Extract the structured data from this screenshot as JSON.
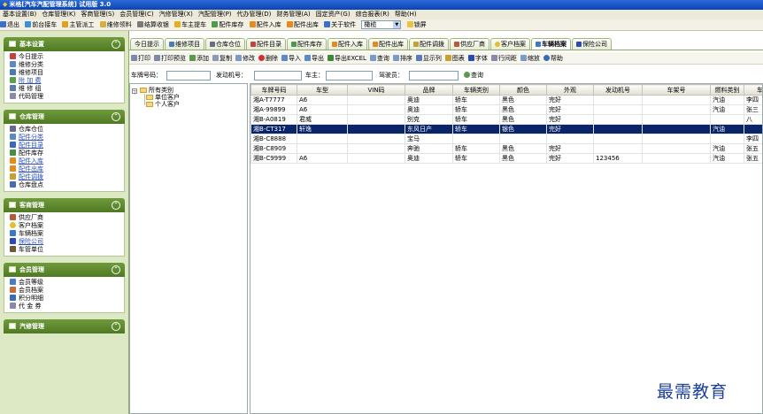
{
  "window": {
    "title": "米格[汽车汽配管理系统] 试用版 3.0"
  },
  "menu": [
    "基本设置(B)",
    "仓库管理(K)",
    "客商管理(S)",
    "会员管理(C)",
    "汽修管理(X)",
    "汽配管理(P)",
    "代办管理(D)",
    "财务管理(A)",
    "固定资产(G)",
    "综合报表(R)",
    "帮助(H)"
  ],
  "toolbar": {
    "items": [
      {
        "label": "退出",
        "icon": "exit-icon"
      },
      {
        "label": "前台接车",
        "icon": "car-receive-icon"
      },
      {
        "label": "主管派工",
        "icon": "dispatch-icon"
      },
      {
        "label": "维修领料",
        "icon": "material-icon"
      },
      {
        "label": "结算收银",
        "icon": "cashier-icon"
      },
      {
        "label": "车主提车",
        "icon": "car-pickup-icon"
      },
      {
        "label": "配件库存",
        "icon": "stock-icon"
      },
      {
        "label": "配件入库",
        "icon": "inbound-icon"
      },
      {
        "label": "配件出库",
        "icon": "outbound-icon"
      },
      {
        "label": "关于软件",
        "icon": "about-icon"
      }
    ],
    "skin_value": "橄榄",
    "lock_label": "锁屏"
  },
  "sidebar": {
    "sections": [
      {
        "title": "基本设置",
        "items": [
          {
            "label": "今日提示",
            "icon": "ab-icon",
            "link": false
          },
          {
            "label": "维修分类",
            "icon": "category-icon",
            "link": false
          },
          {
            "label": "维修项目",
            "icon": "repair-item-icon",
            "link": false
          },
          {
            "label": "附 加 费",
            "icon": "fee-icon",
            "link": true
          },
          {
            "label": "维 修 组",
            "icon": "group-icon",
            "link": false
          },
          {
            "label": "代码管理",
            "icon": "code-icon",
            "link": false
          }
        ]
      },
      {
        "title": "仓库管理",
        "items": [
          {
            "label": "仓库仓位",
            "icon": "warehouse-icon",
            "link": false
          },
          {
            "label": "配件分类",
            "icon": "parts-category-icon",
            "link": true
          },
          {
            "label": "配件目录",
            "icon": "parts-catalog-icon",
            "link": true
          },
          {
            "label": "配件库存",
            "icon": "parts-stock-icon",
            "link": false
          },
          {
            "label": "配件入库",
            "icon": "parts-in-icon",
            "link": true
          },
          {
            "label": "配件出库",
            "icon": "parts-out-icon",
            "link": true
          },
          {
            "label": "配件调拨",
            "icon": "transfer-icon",
            "link": true
          },
          {
            "label": "仓库盘点",
            "icon": "inventory-icon",
            "link": false
          }
        ]
      },
      {
        "title": "客商管理",
        "items": [
          {
            "label": "供应厂商",
            "icon": "supplier-icon",
            "link": false
          },
          {
            "label": "客户档案",
            "icon": "customer-icon",
            "link": false
          },
          {
            "label": "车辆档案",
            "icon": "vehicle-icon",
            "link": false
          },
          {
            "label": "保险公司",
            "icon": "insurance-icon",
            "link": true
          },
          {
            "label": "车管单位",
            "icon": "fleet-icon",
            "link": false
          }
        ]
      },
      {
        "title": "会员管理",
        "items": [
          {
            "label": "会员等级",
            "icon": "member-level-icon",
            "link": false
          },
          {
            "label": "会员档案",
            "icon": "member-file-icon",
            "link": false
          },
          {
            "label": "积分明细",
            "icon": "points-icon",
            "link": false
          },
          {
            "label": "代 金 券",
            "icon": "voucher-icon",
            "link": false
          }
        ]
      },
      {
        "title": "汽修管理",
        "items": []
      }
    ]
  },
  "tabs": [
    "今日提示",
    "维修项目",
    "仓库仓位",
    "配件目录",
    "配件库存",
    "配件入库",
    "配件出库",
    "配件调拨",
    "供应厂商",
    "客户档案",
    "车辆档案",
    "保险公司"
  ],
  "active_tab": "车辆档案",
  "subtoolbar": [
    "打印",
    "打印预览",
    "添加",
    "复制",
    "修改",
    "删除",
    "导入",
    "导出",
    "导出EXCEL",
    "查询",
    "排序",
    "显示列",
    "图表",
    "字体",
    "行间距",
    "缩放",
    "帮助"
  ],
  "filter": {
    "plate_label": "车牌号码：",
    "engine_label": "发动机号：",
    "owner_label": "车主：",
    "driver_label": "驾驶员：",
    "search_label": "查询"
  },
  "tree": {
    "root": "所有类别",
    "children": [
      "单位客户",
      "个人客户"
    ]
  },
  "table": {
    "columns": [
      "车牌号码",
      "车型",
      "VIN码",
      "品牌",
      "车辆类别",
      "颜色",
      "外观",
      "发动机号",
      "车架号",
      "燃料类别",
      "车主"
    ],
    "rows": [
      [
        "湘A-T7777",
        "A6",
        "",
        "奥迪",
        "轿车",
        "黑色",
        "完好",
        "",
        "",
        "汽油",
        "李四"
      ],
      [
        "湘A-99899",
        "A6",
        "",
        "奥迪",
        "轿车",
        "黑色",
        "完好",
        "",
        "",
        "汽油",
        "张三"
      ],
      [
        "湘B-A0819",
        "君威",
        "",
        "别克",
        "轿车",
        "黑色",
        "完好",
        "",
        "",
        "",
        "八"
      ],
      [
        "湘B-CT317",
        "轩逸",
        "",
        "东风日产",
        "轿车",
        "银色",
        "完好",
        "",
        "",
        "汽油",
        ""
      ],
      [
        "湘B-C8888",
        "",
        "",
        "宝马",
        "",
        "",
        "",
        "",
        "",
        "",
        "李四"
      ],
      [
        "湘B-C8909",
        "",
        "",
        "奔驰",
        "轿车",
        "黑色",
        "完好",
        "",
        "",
        "汽油",
        "张五"
      ],
      [
        "湘B-C9999",
        "A6",
        "",
        "奥迪",
        "轿车",
        "黑色",
        "完好",
        "123456",
        "",
        "汽油",
        "张五"
      ]
    ],
    "selected_row": 3
  },
  "watermark": "最需教育",
  "colors": {
    "title_bar": "#0b44b4",
    "sidebar_bg": "#dde8c4",
    "section_header": "#5f8a2e",
    "selected_row": "#0a246a",
    "link": "#2a4fb8"
  }
}
